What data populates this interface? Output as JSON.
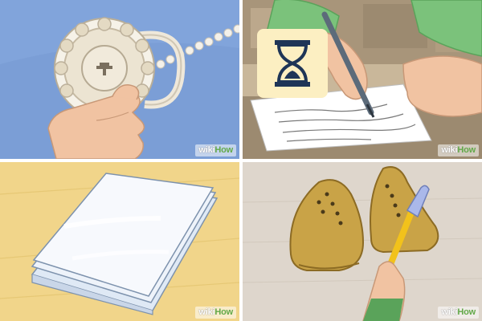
{
  "panels": [
    {
      "id": "pedometer-clip",
      "watermark": {
        "wiki": "wiki",
        "how": "How"
      }
    },
    {
      "id": "writing-hourglass",
      "watermark": {
        "wiki": "wiki",
        "how": "How"
      }
    },
    {
      "id": "paper-stack",
      "watermark": {
        "wiki": "wiki",
        "how": "How"
      }
    },
    {
      "id": "brushing-shoes",
      "watermark": {
        "wiki": "wiki",
        "how": "How"
      }
    }
  ],
  "colors": {
    "blue_bg": "#7b9ed6",
    "beige_bg": "#c9b79a",
    "wood_bg": "#f1d58a",
    "wood_gray_bg": "#ded6cc",
    "shoe": "#c9a347",
    "brush_yellow": "#f2c21b",
    "brush_pad": "#aab8ea",
    "hourglass_box": "#fcefc2",
    "hourglass_navy": "#1e3557",
    "sleeve_green": "#7bc27b",
    "skin": "#f1c3a2"
  },
  "icons": [
    "pedometer-icon",
    "hourglass-icon",
    "pen-icon",
    "paper-stack-icon",
    "shoe-icon",
    "brush-icon"
  ]
}
